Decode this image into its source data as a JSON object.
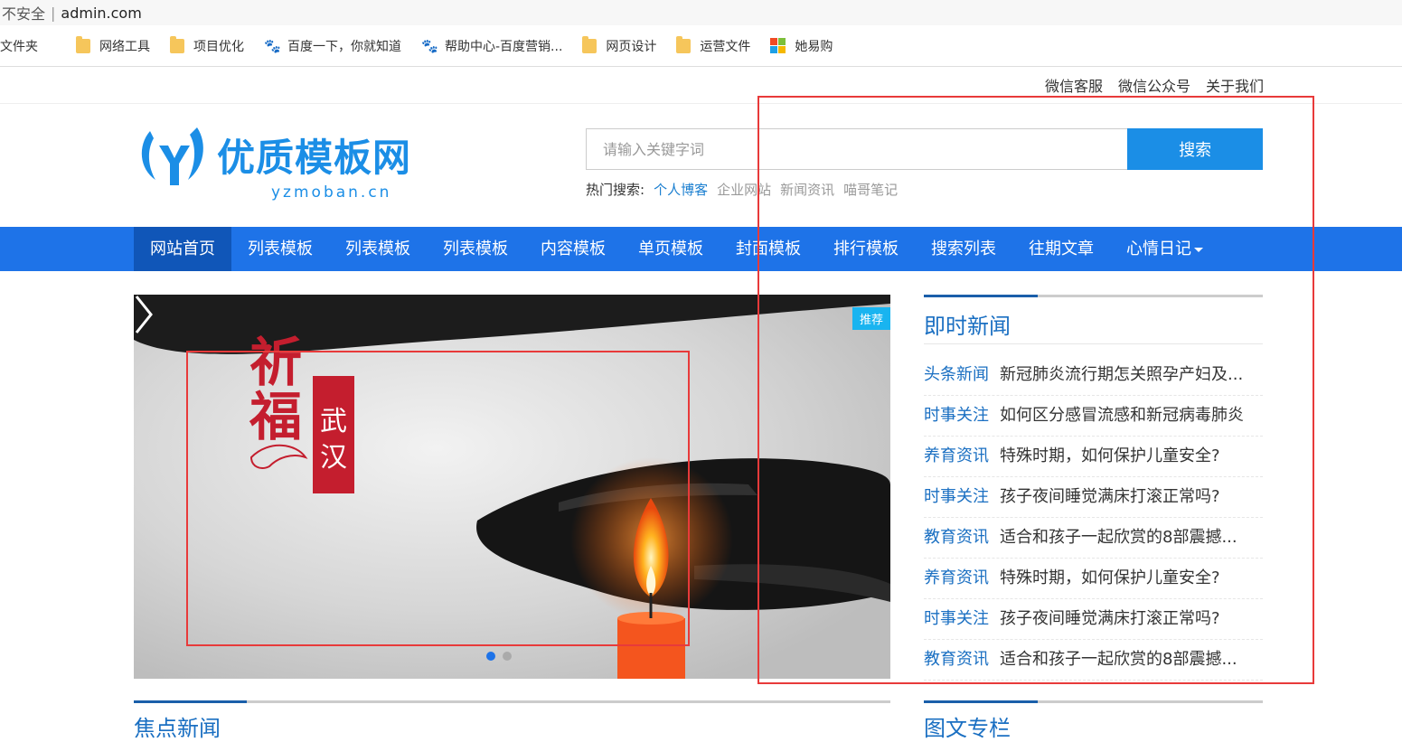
{
  "browser": {
    "security_label": "不安全",
    "url": "admin.com"
  },
  "bookmarks": [
    {
      "label": "文件夹",
      "icon": "none"
    },
    {
      "label": "网络工具",
      "icon": "folder-icon"
    },
    {
      "label": "项目优化",
      "icon": "folder-icon"
    },
    {
      "label": "百度一下，你就知道",
      "icon": "baidu-paw-icon"
    },
    {
      "label": "帮助中心-百度营销...",
      "icon": "baidu-paw-icon"
    },
    {
      "label": "网页设计",
      "icon": "folder-icon"
    },
    {
      "label": "运营文件",
      "icon": "folder-icon"
    },
    {
      "label": "她易购",
      "icon": "tiles-icon"
    }
  ],
  "topbar": {
    "wechat_service": "微信客服",
    "wechat_official": "微信公众号",
    "about": "关于我们"
  },
  "logo": {
    "name": "优质模板网",
    "domain": "yzmoban.cn",
    "brand_color": "#1b8ee6"
  },
  "search": {
    "placeholder": "请输入关键字词",
    "button": "搜索",
    "hot_label": "热门搜索:",
    "hot_keywords": [
      "个人博客",
      "企业网站",
      "新闻资讯",
      "喵哥笔记"
    ]
  },
  "nav": {
    "items": [
      "网站首页",
      "列表模板",
      "列表模板",
      "列表模板",
      "内容模板",
      "单页模板",
      "封面模板",
      "排行模板",
      "搜索列表",
      "往期文章",
      "心情日记"
    ],
    "active_index": 0,
    "color": "#1e73e8"
  },
  "slider": {
    "badge": "推荐",
    "calligraphy_main": "祈福",
    "calligraphy_seal": "武汉"
  },
  "news": {
    "title": "即时新闻",
    "items": [
      {
        "category": "头条新闻",
        "title": "新冠肺炎流行期怎关照孕产妇及..."
      },
      {
        "category": "时事关注",
        "title": "如何区分感冒流感和新冠病毒肺炎"
      },
      {
        "category": "养育资讯",
        "title": "特殊时期，如何保护儿童安全?"
      },
      {
        "category": "时事关注",
        "title": "孩子夜间睡觉满床打滚正常吗?"
      },
      {
        "category": "教育资讯",
        "title": "适合和孩子一起欣赏的8部震撼..."
      },
      {
        "category": "养育资讯",
        "title": "特殊时期，如何保护儿童安全?"
      },
      {
        "category": "时事关注",
        "title": "孩子夜间睡觉满床打滚正常吗?"
      },
      {
        "category": "教育资讯",
        "title": "适合和孩子一起欣赏的8部震撼..."
      }
    ]
  },
  "bottom_sections": {
    "left_title": "焦点新闻",
    "right_title": "图文专栏"
  }
}
